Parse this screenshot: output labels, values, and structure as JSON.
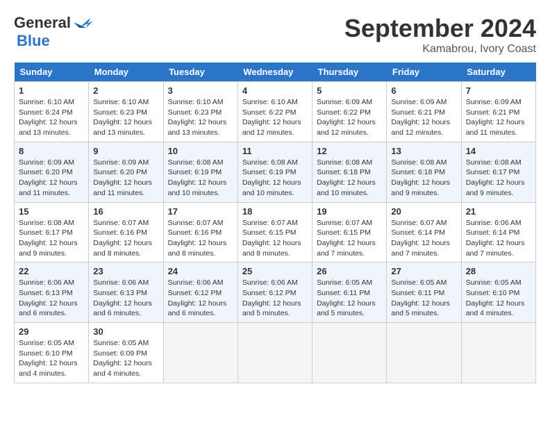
{
  "logo": {
    "line1": "General",
    "line2": "Blue",
    "icon": "▶"
  },
  "title": "September 2024",
  "location": "Kamabrou, Ivory Coast",
  "days_of_week": [
    "Sunday",
    "Monday",
    "Tuesday",
    "Wednesday",
    "Thursday",
    "Friday",
    "Saturday"
  ],
  "weeks": [
    [
      {
        "day": "1",
        "sunrise": "6:10 AM",
        "sunset": "6:24 PM",
        "daylight": "12 hours and 13 minutes."
      },
      {
        "day": "2",
        "sunrise": "6:10 AM",
        "sunset": "6:23 PM",
        "daylight": "12 hours and 13 minutes."
      },
      {
        "day": "3",
        "sunrise": "6:10 AM",
        "sunset": "6:23 PM",
        "daylight": "12 hours and 13 minutes."
      },
      {
        "day": "4",
        "sunrise": "6:10 AM",
        "sunset": "6:22 PM",
        "daylight": "12 hours and 12 minutes."
      },
      {
        "day": "5",
        "sunrise": "6:09 AM",
        "sunset": "6:22 PM",
        "daylight": "12 hours and 12 minutes."
      },
      {
        "day": "6",
        "sunrise": "6:09 AM",
        "sunset": "6:21 PM",
        "daylight": "12 hours and 12 minutes."
      },
      {
        "day": "7",
        "sunrise": "6:09 AM",
        "sunset": "6:21 PM",
        "daylight": "12 hours and 11 minutes."
      }
    ],
    [
      {
        "day": "8",
        "sunrise": "6:09 AM",
        "sunset": "6:20 PM",
        "daylight": "12 hours and 11 minutes."
      },
      {
        "day": "9",
        "sunrise": "6:09 AM",
        "sunset": "6:20 PM",
        "daylight": "12 hours and 11 minutes."
      },
      {
        "day": "10",
        "sunrise": "6:08 AM",
        "sunset": "6:19 PM",
        "daylight": "12 hours and 10 minutes."
      },
      {
        "day": "11",
        "sunrise": "6:08 AM",
        "sunset": "6:19 PM",
        "daylight": "12 hours and 10 minutes."
      },
      {
        "day": "12",
        "sunrise": "6:08 AM",
        "sunset": "6:18 PM",
        "daylight": "12 hours and 10 minutes."
      },
      {
        "day": "13",
        "sunrise": "6:08 AM",
        "sunset": "6:18 PM",
        "daylight": "12 hours and 9 minutes."
      },
      {
        "day": "14",
        "sunrise": "6:08 AM",
        "sunset": "6:17 PM",
        "daylight": "12 hours and 9 minutes."
      }
    ],
    [
      {
        "day": "15",
        "sunrise": "6:08 AM",
        "sunset": "6:17 PM",
        "daylight": "12 hours and 9 minutes."
      },
      {
        "day": "16",
        "sunrise": "6:07 AM",
        "sunset": "6:16 PM",
        "daylight": "12 hours and 8 minutes."
      },
      {
        "day": "17",
        "sunrise": "6:07 AM",
        "sunset": "6:16 PM",
        "daylight": "12 hours and 8 minutes."
      },
      {
        "day": "18",
        "sunrise": "6:07 AM",
        "sunset": "6:15 PM",
        "daylight": "12 hours and 8 minutes."
      },
      {
        "day": "19",
        "sunrise": "6:07 AM",
        "sunset": "6:15 PM",
        "daylight": "12 hours and 7 minutes."
      },
      {
        "day": "20",
        "sunrise": "6:07 AM",
        "sunset": "6:14 PM",
        "daylight": "12 hours and 7 minutes."
      },
      {
        "day": "21",
        "sunrise": "6:06 AM",
        "sunset": "6:14 PM",
        "daylight": "12 hours and 7 minutes."
      }
    ],
    [
      {
        "day": "22",
        "sunrise": "6:06 AM",
        "sunset": "6:13 PM",
        "daylight": "12 hours and 6 minutes."
      },
      {
        "day": "23",
        "sunrise": "6:06 AM",
        "sunset": "6:13 PM",
        "daylight": "12 hours and 6 minutes."
      },
      {
        "day": "24",
        "sunrise": "6:06 AM",
        "sunset": "6:12 PM",
        "daylight": "12 hours and 6 minutes."
      },
      {
        "day": "25",
        "sunrise": "6:06 AM",
        "sunset": "6:12 PM",
        "daylight": "12 hours and 5 minutes."
      },
      {
        "day": "26",
        "sunrise": "6:05 AM",
        "sunset": "6:11 PM",
        "daylight": "12 hours and 5 minutes."
      },
      {
        "day": "27",
        "sunrise": "6:05 AM",
        "sunset": "6:11 PM",
        "daylight": "12 hours and 5 minutes."
      },
      {
        "day": "28",
        "sunrise": "6:05 AM",
        "sunset": "6:10 PM",
        "daylight": "12 hours and 4 minutes."
      }
    ],
    [
      {
        "day": "29",
        "sunrise": "6:05 AM",
        "sunset": "6:10 PM",
        "daylight": "12 hours and 4 minutes."
      },
      {
        "day": "30",
        "sunrise": "6:05 AM",
        "sunset": "6:09 PM",
        "daylight": "12 hours and 4 minutes."
      },
      null,
      null,
      null,
      null,
      null
    ]
  ],
  "labels": {
    "sunrise_prefix": "Sunrise: ",
    "sunset_prefix": "Sunset: ",
    "daylight_prefix": "Daylight: "
  }
}
